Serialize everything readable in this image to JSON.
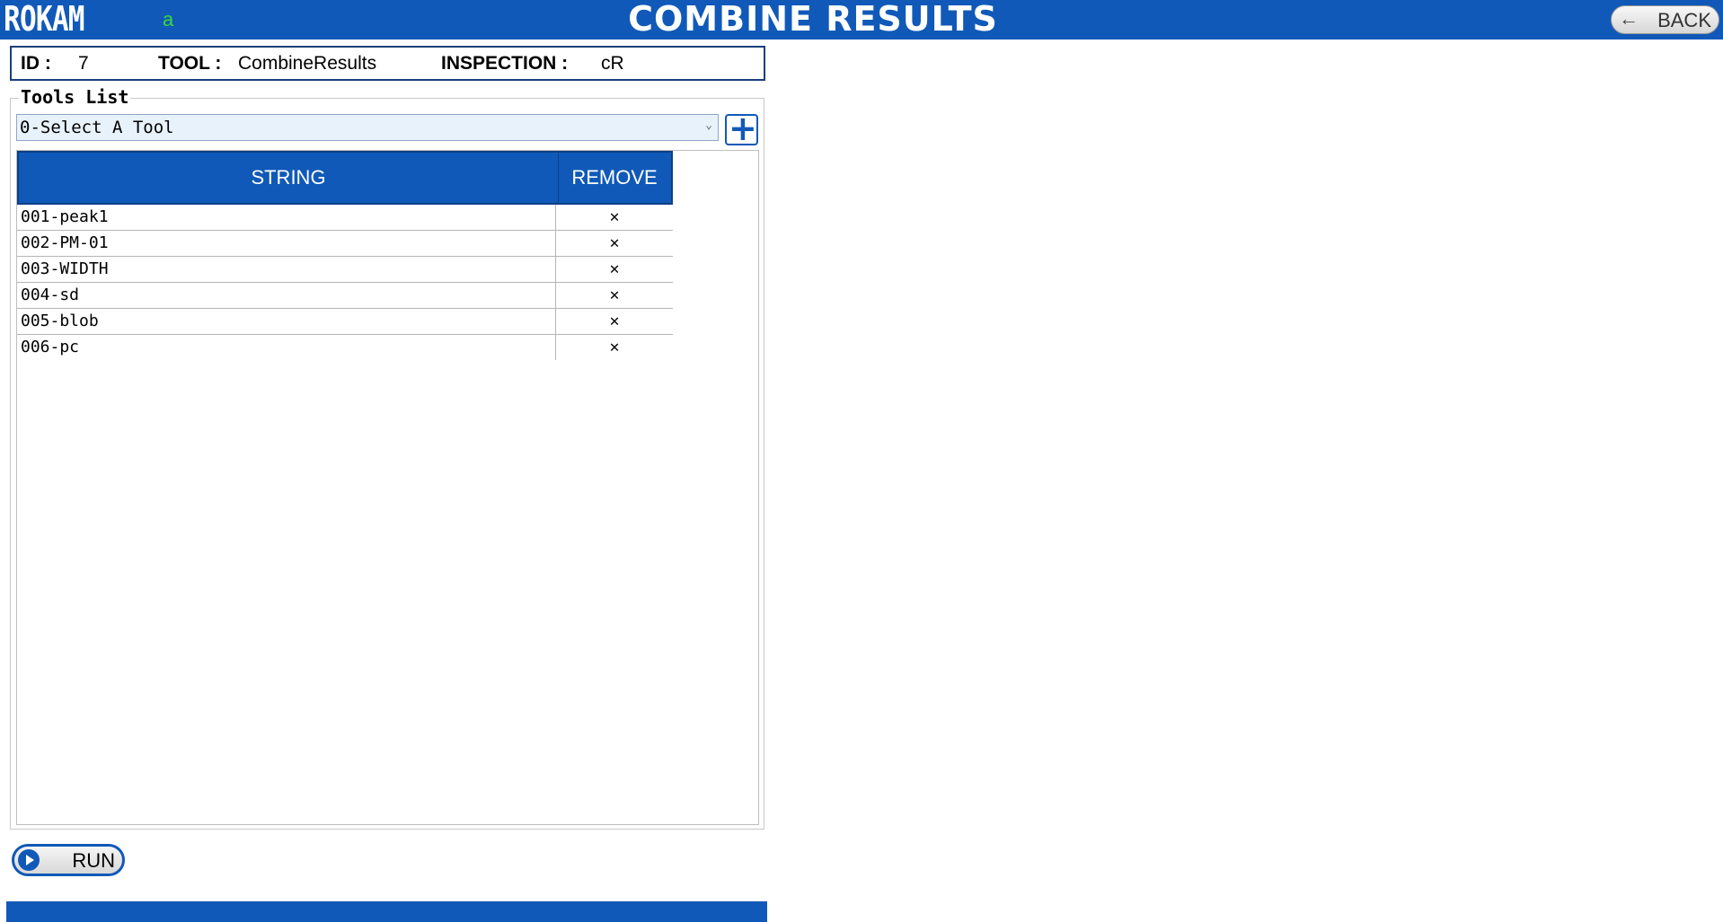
{
  "header": {
    "logo": "ROKAM",
    "user_tag": "a",
    "title": "COMBINE RESULTS",
    "back_label": "BACK"
  },
  "info": {
    "id_label": "ID :",
    "id_value": "7",
    "tool_label": "TOOL :",
    "tool_value": "CombineResults",
    "inspection_label": "INSPECTION :",
    "inspection_value": "cR"
  },
  "tools": {
    "legend": "Tools List",
    "select_value": "0-Select A Tool",
    "add_icon": "plus-icon"
  },
  "grid": {
    "columns": [
      "STRING",
      "REMOVE"
    ],
    "rows": [
      {
        "string": "001-peak1",
        "remove": "✕"
      },
      {
        "string": "002-PM-01",
        "remove": "✕"
      },
      {
        "string": "003-WIDTH",
        "remove": "✕"
      },
      {
        "string": "004-sd",
        "remove": "✕"
      },
      {
        "string": "005-blob",
        "remove": "✕"
      },
      {
        "string": "006-pc",
        "remove": "✕"
      }
    ]
  },
  "run": {
    "label": "RUN"
  },
  "colors": {
    "primary": "#1059b8",
    "user_tag": "#3cd63c",
    "select_bg": "#e8f2fb"
  }
}
